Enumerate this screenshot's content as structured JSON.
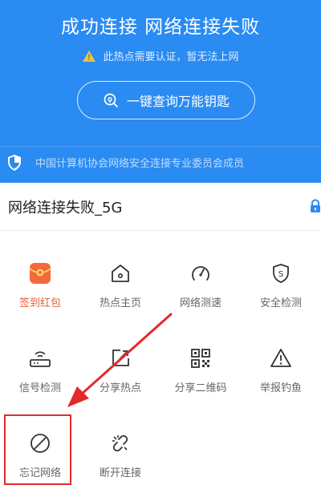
{
  "header": {
    "title": "成功连接 网络连接失败",
    "warning": "此热点需要认证，暂无法上网",
    "key_button": "一键查询万能钥匙",
    "certification": "中国计算机协会网络安全连接专业委员会成员",
    "bg_color": "#2a8bf2"
  },
  "network": {
    "name": "网络连接失败_5G",
    "lock_icon": "lock-icon"
  },
  "grid": [
    {
      "label": "签到红包",
      "icon": "red-envelope-icon"
    },
    {
      "label": "热点主页",
      "icon": "home-icon"
    },
    {
      "label": "网络测速",
      "icon": "speedometer-icon"
    },
    {
      "label": "安全检测",
      "icon": "shield-s-icon"
    },
    {
      "label": "信号检测",
      "icon": "router-icon"
    },
    {
      "label": "分享热点",
      "icon": "share-icon"
    },
    {
      "label": "分享二维码",
      "icon": "qrcode-icon"
    },
    {
      "label": "举报钓鱼",
      "icon": "warning-triangle-icon"
    },
    {
      "label": "忘记网络",
      "icon": "forbidden-icon"
    },
    {
      "label": "断开连接",
      "icon": "broken-link-icon"
    }
  ],
  "annotation": {
    "color": "#e32a2a"
  }
}
